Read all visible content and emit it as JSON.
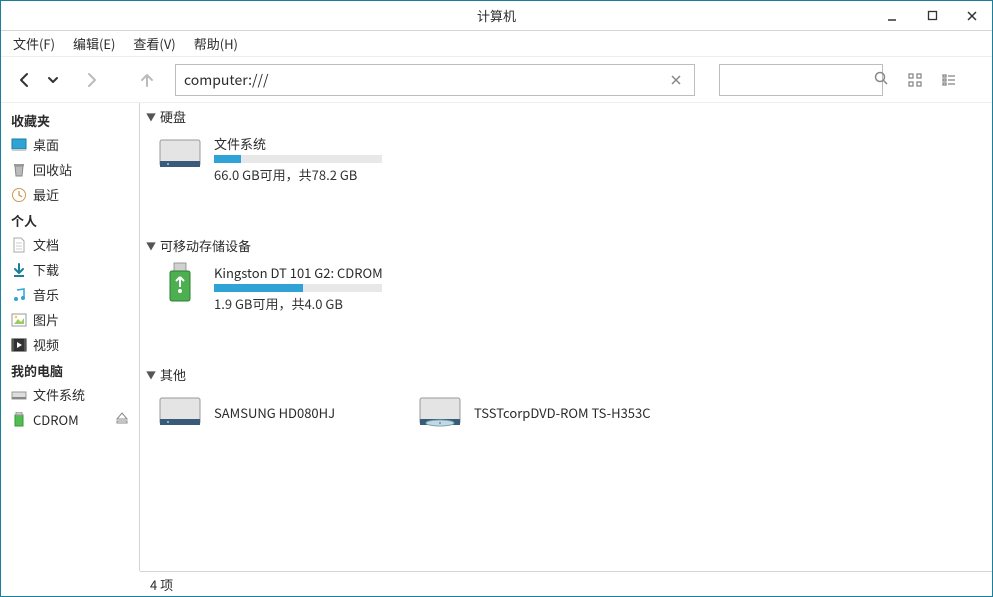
{
  "window": {
    "title": "计算机"
  },
  "menus": {
    "file": "文件(F)",
    "edit": "编辑(E)",
    "view": "查看(V)",
    "help": "帮助(H)"
  },
  "location": {
    "value": "computer:///"
  },
  "sidebar": {
    "favorites": {
      "title": "收藏夹",
      "desktop": "桌面",
      "trash": "回收站",
      "recent": "最近"
    },
    "personal": {
      "title": "个人",
      "documents": "文档",
      "downloads": "下载",
      "music": "音乐",
      "pictures": "图片",
      "videos": "视频"
    },
    "computer": {
      "title": "我的电脑",
      "filesystem": "文件系统",
      "cdrom": "CDROM"
    }
  },
  "sections": {
    "hdd": {
      "title": "硬盘",
      "item0": {
        "name": "文件系统",
        "sub": "66.0 GB可用，共78.2 GB",
        "fill_pct": "16%"
      }
    },
    "removable": {
      "title": "可移动存储设备",
      "item0": {
        "name": "Kingston DT 101 G2: CDROM",
        "sub": "1.9 GB可用，共4.0 GB",
        "fill_pct": "53%"
      }
    },
    "other": {
      "title": "其他",
      "item0": {
        "name": "SAMSUNG HD080HJ"
      },
      "item1": {
        "name": "TSSTcorpDVD-ROM TS-H353C"
      }
    }
  },
  "status": {
    "text": "4 项"
  }
}
